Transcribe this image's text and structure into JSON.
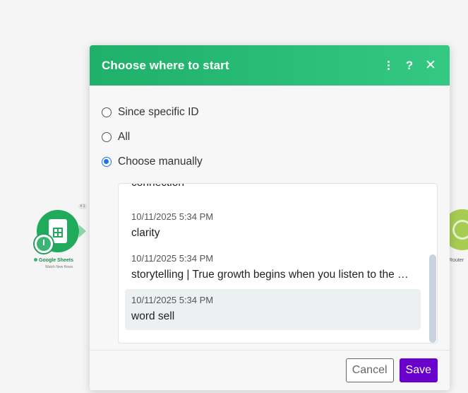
{
  "dialog": {
    "title": "Choose where to start",
    "options": [
      {
        "label": "Since specific ID",
        "checked": false
      },
      {
        "label": "All",
        "checked": false
      },
      {
        "label": "Choose manually",
        "checked": true
      }
    ],
    "items": [
      {
        "timestamp": "",
        "text": "connection"
      },
      {
        "timestamp": "10/11/2025 5:34 PM",
        "text": "clarity"
      },
      {
        "timestamp": "10/11/2025 5:34 PM",
        "text": "storytelling | True growth begins when you listen to the unspoken needs of your customers."
      },
      {
        "timestamp": "10/11/2025 5:34 PM",
        "text": "word sell",
        "selected": true
      }
    ],
    "cancel_label": "Cancel",
    "save_label": "Save"
  },
  "canvas": {
    "sheets_node": {
      "label": "Google Sheets",
      "sublabel": "Watch New Rows",
      "badge": "# 1"
    },
    "router_node": {
      "label": "Router"
    }
  },
  "colors": {
    "header": "#1fb06a",
    "save_button": "#6a00cc",
    "radio_selected": "#1a73e8",
    "sheets_node": "#1faa5c",
    "router_node": "#a6cc52"
  }
}
